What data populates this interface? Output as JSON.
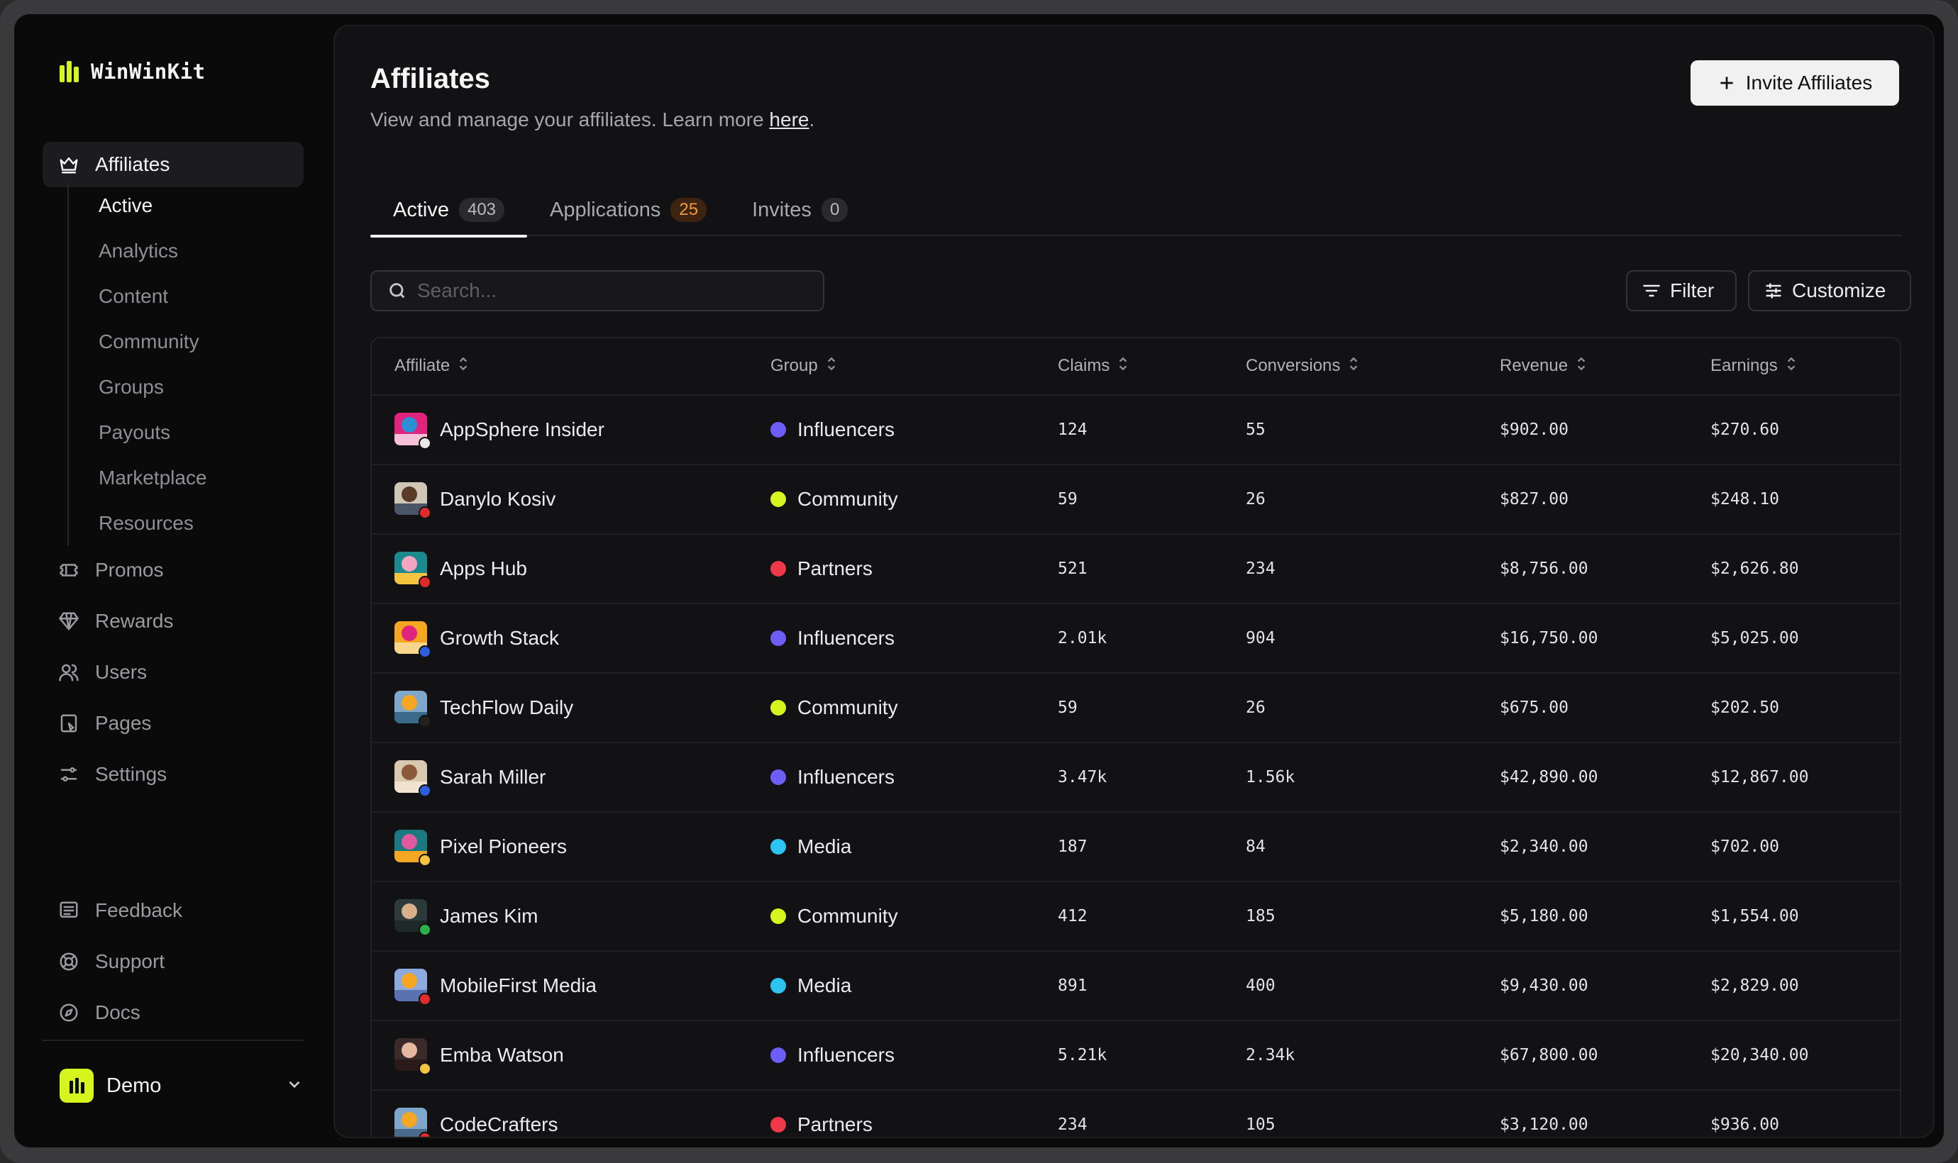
{
  "brand": {
    "name": "WinWinKit",
    "accent": "#d6f51f"
  },
  "sidebar": {
    "primary": {
      "label": "Affiliates",
      "icon": "crown-icon"
    },
    "sub_items": [
      "Active",
      "Analytics",
      "Content",
      "Community",
      "Groups",
      "Payouts",
      "Marketplace",
      "Resources"
    ],
    "items": [
      {
        "label": "Promos",
        "icon": "ticket-icon"
      },
      {
        "label": "Rewards",
        "icon": "gem-icon"
      },
      {
        "label": "Users",
        "icon": "users-icon"
      },
      {
        "label": "Pages",
        "icon": "page-icon"
      },
      {
        "label": "Settings",
        "icon": "settings-icon"
      }
    ],
    "footer_items": [
      {
        "label": "Feedback",
        "icon": "feedback-icon"
      },
      {
        "label": "Support",
        "icon": "lifebuoy-icon"
      },
      {
        "label": "Docs",
        "icon": "compass-icon"
      }
    ],
    "workspace": {
      "name": "Demo"
    }
  },
  "header": {
    "title": "Affiliates",
    "subtitle": "View and manage your affiliates. Learn more",
    "link_text": "here",
    "subtitle_end": ".",
    "invite_label": "Invite Affiliates"
  },
  "tabs": [
    {
      "label": "Active",
      "count": "403"
    },
    {
      "label": "Applications",
      "count": "25"
    },
    {
      "label": "Invites",
      "count": "0"
    }
  ],
  "toolbar": {
    "search_placeholder": "Search...",
    "filter_label": "Filter",
    "customize_label": "Customize"
  },
  "table": {
    "columns": [
      "Affiliate",
      "Group",
      "Claims",
      "Conversions",
      "Revenue",
      "Earnings"
    ],
    "group_colors": {
      "Influencers": "#6d5ef5",
      "Community": "#d6f51f",
      "Partners": "#f0384b",
      "Media": "#2ec4f2"
    },
    "rows": [
      {
        "name": "AppSphere Insider",
        "group": "Influencers",
        "claims": "124",
        "conversions": "55",
        "revenue": "$902.00",
        "earnings": "$270.60",
        "bg": "#e0237c",
        "c1": "#2a8fd6",
        "c2": "#f6c1d8",
        "flag": "#e8e8e8"
      },
      {
        "name": "Danylo Kosiv",
        "group": "Community",
        "claims": "59",
        "conversions": "26",
        "revenue": "$827.00",
        "earnings": "$248.10",
        "bg": "#cfc6b8",
        "c1": "#5a3b2a",
        "c2": "#4a5568",
        "flag": "#e02b2b"
      },
      {
        "name": "Apps Hub",
        "group": "Partners",
        "claims": "521",
        "conversions": "234",
        "revenue": "$8,756.00",
        "earnings": "$2,626.80",
        "bg": "#1b8a8f",
        "c1": "#f4a6c0",
        "c2": "#f5c542",
        "flag": "#e02b2b"
      },
      {
        "name": "Growth Stack",
        "group": "Influencers",
        "claims": "2.01k",
        "conversions": "904",
        "revenue": "$16,750.00",
        "earnings": "$5,025.00",
        "bg": "#f5a623",
        "c1": "#e0237c",
        "c2": "#f7d58a",
        "flag": "#2b5fe0"
      },
      {
        "name": "TechFlow Daily",
        "group": "Community",
        "claims": "59",
        "conversions": "26",
        "revenue": "$675.00",
        "earnings": "$202.50",
        "bg": "#7fa7c9",
        "c1": "#f5a623",
        "c2": "#3a6b8a",
        "flag": "#222222"
      },
      {
        "name": "Sarah Miller",
        "group": "Influencers",
        "claims": "3.47k",
        "conversions": "1.56k",
        "revenue": "$42,890.00",
        "earnings": "$12,867.00",
        "bg": "#d9c9b0",
        "c1": "#8a5a3a",
        "c2": "#efe3cf",
        "flag": "#2b5fe0"
      },
      {
        "name": "Pixel Pioneers",
        "group": "Media",
        "claims": "187",
        "conversions": "84",
        "revenue": "$2,340.00",
        "earnings": "$702.00",
        "bg": "#1b7a7f",
        "c1": "#e05aa0",
        "c2": "#f5a623",
        "flag": "#f5c542"
      },
      {
        "name": "James Kim",
        "group": "Community",
        "claims": "412",
        "conversions": "185",
        "revenue": "$5,180.00",
        "earnings": "$1,554.00",
        "bg": "#2c3a3a",
        "c1": "#d9b08a",
        "c2": "#1e2a2a",
        "flag": "#2bb04a"
      },
      {
        "name": "MobileFirst Media",
        "group": "Media",
        "claims": "891",
        "conversions": "400",
        "revenue": "$9,430.00",
        "earnings": "$2,829.00",
        "bg": "#8ea8e0",
        "c1": "#f5a623",
        "c2": "#5a72b0",
        "flag": "#e02b2b"
      },
      {
        "name": "Emba Watson",
        "group": "Influencers",
        "claims": "5.21k",
        "conversions": "2.34k",
        "revenue": "$67,800.00",
        "earnings": "$20,340.00",
        "bg": "#3a2a2a",
        "c1": "#e8b8a0",
        "c2": "#2a1a1a",
        "flag": "#f5c542"
      },
      {
        "name": "CodeCrafters",
        "group": "Partners",
        "claims": "234",
        "conversions": "105",
        "revenue": "$3,120.00",
        "earnings": "$936.00",
        "bg": "#7fa7c9",
        "c1": "#f5a623",
        "c2": "#4a6a8a",
        "flag": "#e02b2b"
      }
    ]
  }
}
